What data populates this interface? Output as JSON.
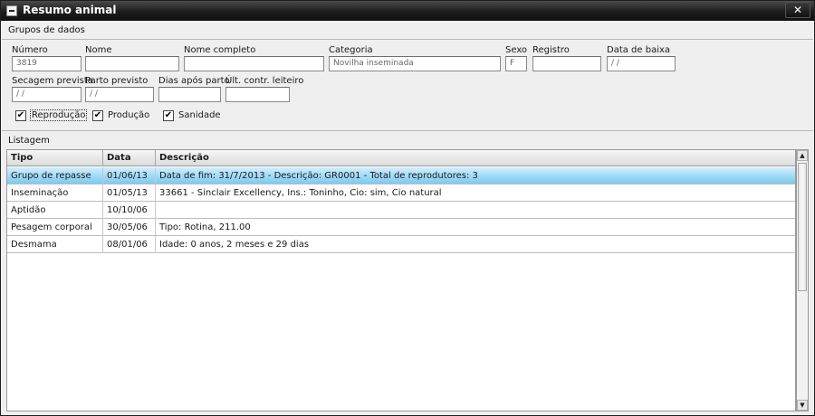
{
  "window": {
    "title": "Resumo animal",
    "close_glyph": "✕"
  },
  "groups": {
    "label": "Grupos de dados"
  },
  "fields": {
    "numero": {
      "label": "Número",
      "value": "3819"
    },
    "nome": {
      "label": "Nome",
      "value": ""
    },
    "nome_completo": {
      "label": "Nome completo",
      "value": ""
    },
    "categoria": {
      "label": "Categoria",
      "value": "Novilha inseminada"
    },
    "sexo": {
      "label": "Sexo",
      "value": "F"
    },
    "registro": {
      "label": "Registro",
      "value": ""
    },
    "data_baixa": {
      "label": "Data de baixa",
      "value": " /  /"
    },
    "secagem_prevista": {
      "label": "Secagem prevista",
      "value": " /  /"
    },
    "parto_previsto": {
      "label": "Parto previsto",
      "value": " /  /"
    },
    "dias_apos_parto": {
      "label": "Dias após parto",
      "value": ""
    },
    "ult_contr_leiteiro": {
      "label": "Últ. contr. leiteiro",
      "value": ""
    }
  },
  "checks": {
    "reproducao": {
      "label": "Reprodução",
      "checked": true
    },
    "producao": {
      "label": "Produção",
      "checked": true
    },
    "sanidade": {
      "label": "Sanidade",
      "checked": true
    },
    "glyph": "✔"
  },
  "listing": {
    "label": "Listagem",
    "columns": {
      "tipo": "Tipo",
      "data": "Data",
      "descricao": "Descrição"
    },
    "rows": [
      {
        "tipo": "Grupo de repasse",
        "data": "01/06/13",
        "descricao": "Data de fim: 31/7/2013 - Descrição: GR0001 - Total de reprodutores: 3"
      },
      {
        "tipo": "Inseminação",
        "data": "01/05/13",
        "descricao": "33661 - Sinclair Excellency, Ins.: Toninho, Cio: sim, Cio natural"
      },
      {
        "tipo": "Aptidão",
        "data": "10/10/06",
        "descricao": ""
      },
      {
        "tipo": "Pesagem corporal",
        "data": "30/05/06",
        "descricao": "Tipo: Rotina, 211.00"
      },
      {
        "tipo": "Desmama",
        "data": "08/01/06",
        "descricao": "Idade: 0 anos, 2 meses e 29 dias"
      }
    ],
    "selected_row": 0
  },
  "scrollbar": {
    "up_glyph": "▲",
    "down_glyph": "▼"
  }
}
